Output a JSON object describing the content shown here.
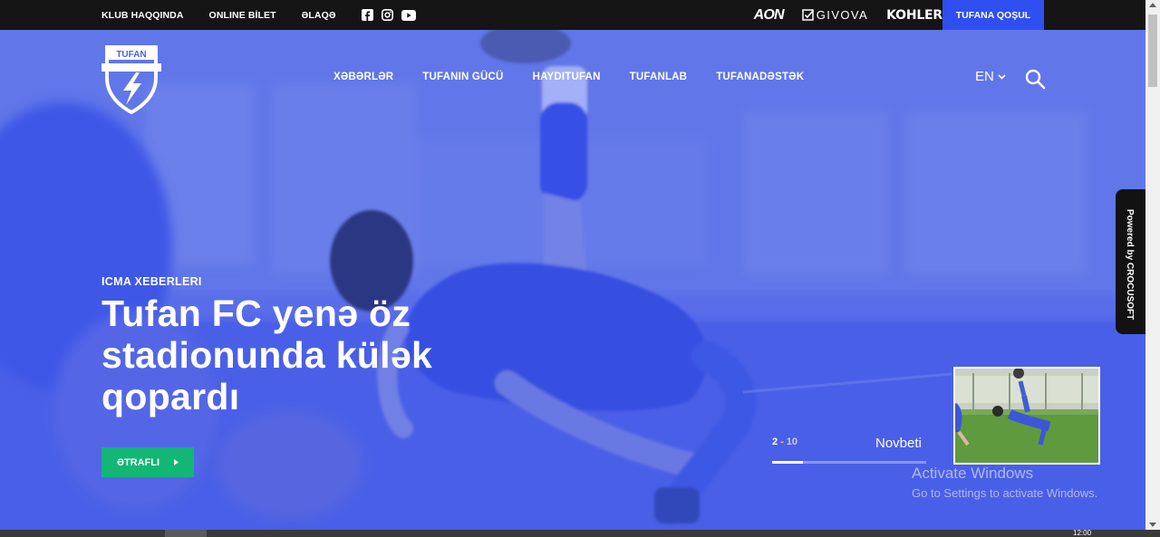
{
  "topbar": {
    "links": [
      "KLUB HAQQINDA",
      "ONLINE BİLET",
      "ƏLAQƏ"
    ],
    "social_icons": [
      "facebook-icon",
      "instagram-icon",
      "youtube-icon"
    ],
    "sponsors": {
      "aon": "AON",
      "givova": "GIVOVA",
      "kohler": "KOHLER"
    },
    "join_label": "TUFANA QOŞUL"
  },
  "header": {
    "logo_text": "TUFAN",
    "nav": [
      "XƏBƏRLƏR",
      "TUFANIN GÜCÜ",
      "HAYDITUFAN",
      "TUFANLAB",
      "TUFANADƏSTƏK"
    ],
    "language": "EN"
  },
  "hero": {
    "category": "ICMA XEBERLERI",
    "headline": "Tufan FC yenə öz stadionunda külək qopardı",
    "more_label": "ƏTRAFLI",
    "current_slide": "2",
    "separator": "-",
    "total_slides": "10",
    "next_label": "Novbeti",
    "progress": 0.2
  },
  "side_badge": "Powered by CROCUSOFT",
  "watermark": {
    "title": "Activate Windows",
    "subtitle": "Go to Settings to activate Windows."
  },
  "taskbar": {
    "clock": "12:00"
  },
  "colors": {
    "accent": "#2f4ff0",
    "cta": "#12b675",
    "overlay": "#4f63e4"
  }
}
